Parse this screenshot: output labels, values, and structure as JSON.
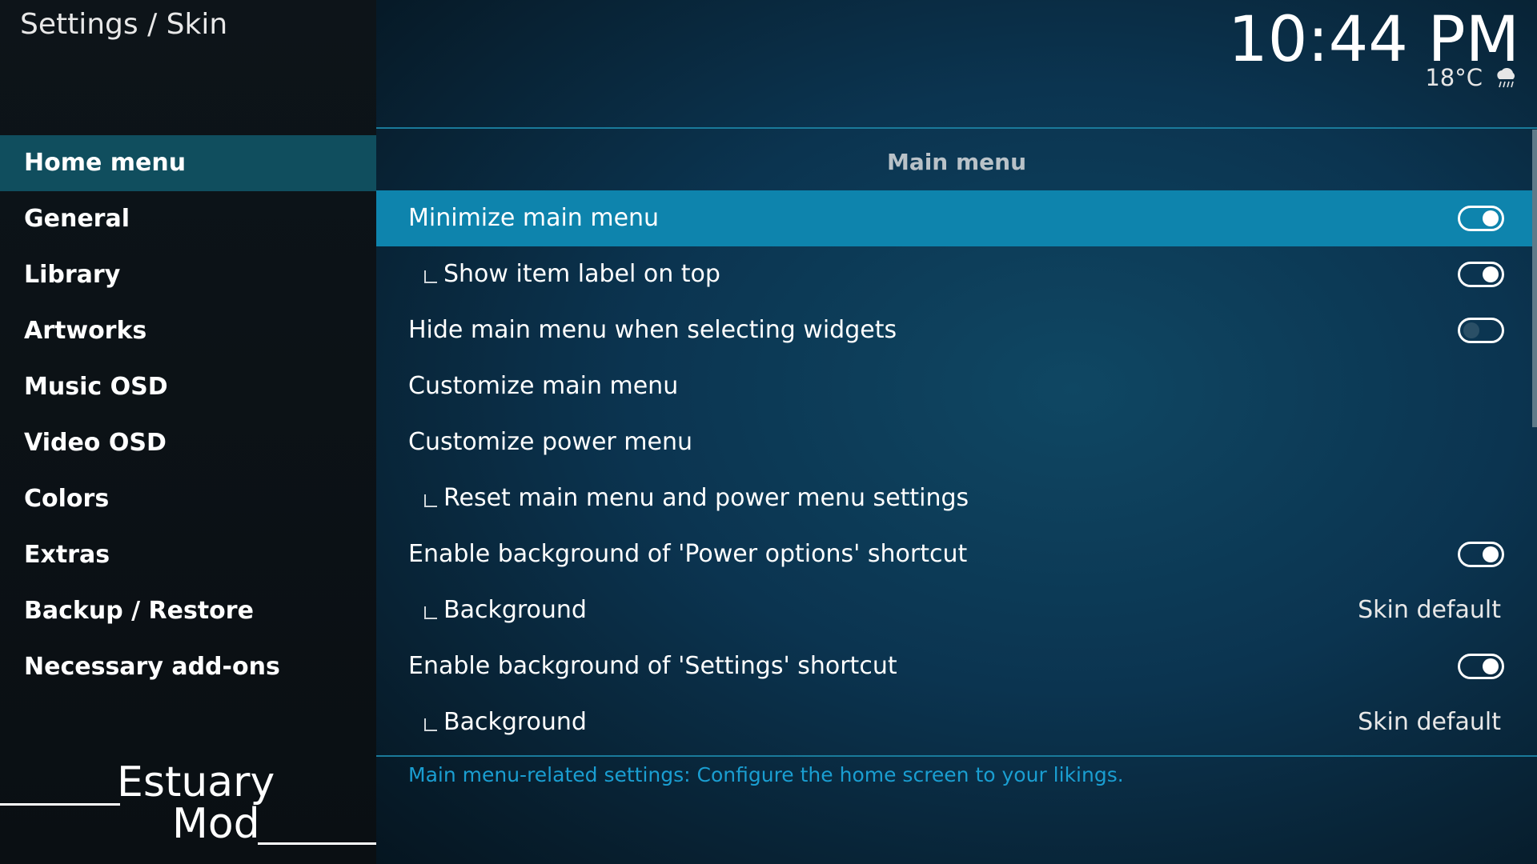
{
  "breadcrumb": "Settings / Skin",
  "clock": {
    "time": "10:44 PM",
    "temperature": "18°C",
    "weather_icon": "rain-cloud-icon"
  },
  "sidebar": {
    "items": [
      {
        "label": "Home menu",
        "active": true
      },
      {
        "label": "General",
        "active": false
      },
      {
        "label": "Library",
        "active": false
      },
      {
        "label": "Artworks",
        "active": false
      },
      {
        "label": "Music OSD",
        "active": false
      },
      {
        "label": "Video OSD",
        "active": false
      },
      {
        "label": "Colors",
        "active": false
      },
      {
        "label": "Extras",
        "active": false
      },
      {
        "label": "Backup / Restore",
        "active": false
      },
      {
        "label": "Necessary add-ons",
        "active": false
      }
    ]
  },
  "logo": {
    "word1": "Estuary",
    "word2": "Mod"
  },
  "main": {
    "section_title": "Main menu",
    "rows": [
      {
        "label": "Minimize main menu",
        "sub": false,
        "control": "toggle",
        "on": true,
        "focused": true
      },
      {
        "label": "Show item label on top",
        "sub": true,
        "control": "toggle",
        "on": true,
        "focused": false
      },
      {
        "label": "Hide main menu when selecting widgets",
        "sub": false,
        "control": "toggle",
        "on": false,
        "focused": false
      },
      {
        "label": "Customize main menu",
        "sub": false,
        "control": "none",
        "focused": false
      },
      {
        "label": "Customize power menu",
        "sub": false,
        "control": "none",
        "focused": false
      },
      {
        "label": "Reset main menu and power menu settings",
        "sub": true,
        "control": "none",
        "focused": false
      },
      {
        "label": "Enable background of 'Power options' shortcut",
        "sub": false,
        "control": "toggle",
        "on": true,
        "focused": false
      },
      {
        "label": "Background",
        "sub": true,
        "control": "value",
        "value": "Skin default",
        "focused": false
      },
      {
        "label": "Enable background of 'Settings' shortcut",
        "sub": false,
        "control": "toggle",
        "on": true,
        "focused": false
      },
      {
        "label": "Background",
        "sub": true,
        "control": "value",
        "value": "Skin default",
        "focused": false
      }
    ],
    "description": "Main menu-related settings: Configure the home screen to your likings."
  },
  "colors": {
    "accent": "#0e84ad",
    "sidebar_active": "#104e5e",
    "description_text": "#1a9ed1"
  }
}
